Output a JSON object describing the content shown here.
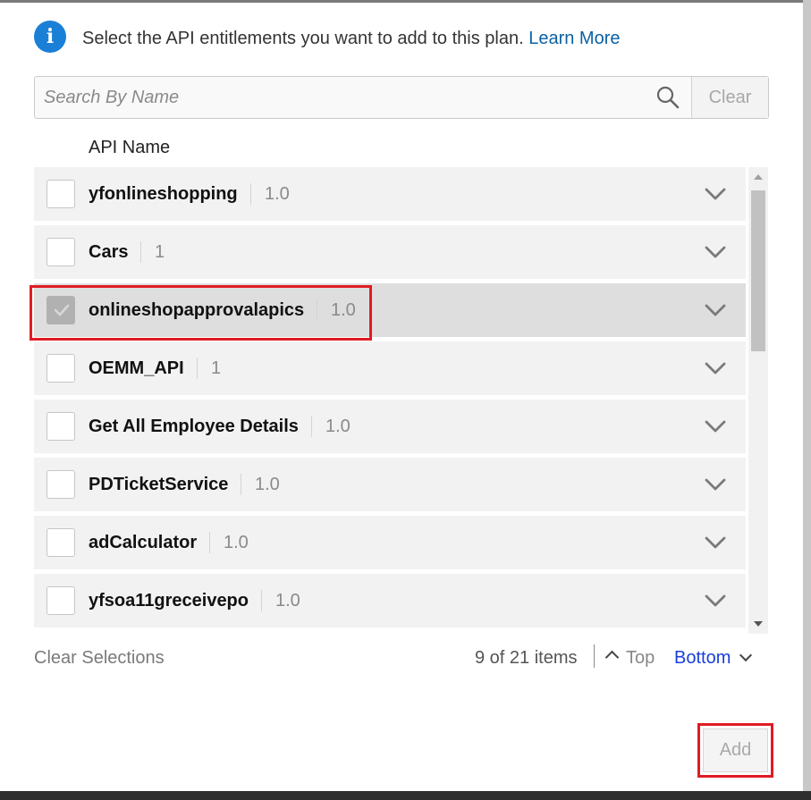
{
  "intro": {
    "text": "Select the API entitlements you want to add to this plan.",
    "link": "Learn More",
    "icon": "info-icon"
  },
  "search": {
    "placeholder": "Search By Name",
    "value": "",
    "clear_label": "Clear",
    "icon": "search-icon"
  },
  "list": {
    "column_header": "API Name",
    "rows": [
      {
        "name": "yfonlineshopping",
        "version": "1.0",
        "checked": false
      },
      {
        "name": "Cars",
        "version": "1",
        "checked": false
      },
      {
        "name": "onlineshopapprovalapics",
        "version": "1.0",
        "checked": true
      },
      {
        "name": "OEMM_API",
        "version": "1",
        "checked": false
      },
      {
        "name": "Get All Employee Details",
        "version": "1.0",
        "checked": false
      },
      {
        "name": "PDTicketService",
        "version": "1.0",
        "checked": false
      },
      {
        "name": "adCalculator",
        "version": "1.0",
        "checked": false
      },
      {
        "name": "yfsoa11greceivepo",
        "version": "1.0",
        "checked": false
      }
    ]
  },
  "footer": {
    "clear_selections": "Clear Selections",
    "count": "9 of 21 items",
    "top": "Top",
    "bottom": "Bottom"
  },
  "actions": {
    "add": "Add"
  },
  "colors": {
    "link": "#0b61a4",
    "info": "#1a7fd6",
    "highlight": "#e01b24",
    "bottom_link": "#1a3ed9"
  }
}
